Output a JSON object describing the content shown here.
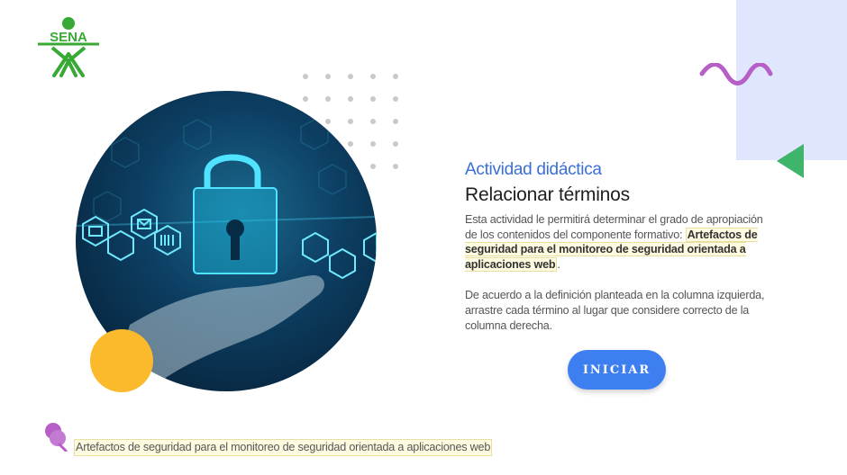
{
  "logo": {
    "text": "SENA",
    "color": "#39a935"
  },
  "activity": {
    "kicker": "Actividad didáctica",
    "title": "Relacionar términos",
    "description_lead": "Esta actividad le permitirá determinar el grado de apropiación de los contenidos del componente formativo:",
    "component_name": "Artefactos de seguridad para el monitoreo de seguridad orientada a aplicaciones web",
    "description_end": ".",
    "instructions": "De acuerdo a la definición planteada en la columna izquierda, arrastre cada término al lugar que considere correcto de la columna derecha."
  },
  "start_button": {
    "label": "INICIAR"
  },
  "footer": {
    "component_name": "Artefactos de seguridad para el monitoreo de seguridad orientada a aplicaciones web"
  },
  "colors": {
    "accent_blue": "#3d7ff0",
    "kicker_blue": "#3a6fd8",
    "yellow": "#fbba2c",
    "green": "#3fb56b",
    "purple": "#b55fc7",
    "lavender": "#dfe6fd"
  },
  "icons": [
    "sena-logo-icon",
    "padlock-icon",
    "hand-icon",
    "video-icon",
    "mail-icon",
    "phone-icon",
    "barcode-icon",
    "cloud-icon",
    "cart-icon",
    "pushpin-icon",
    "wave-icon",
    "triangle-icon"
  ]
}
